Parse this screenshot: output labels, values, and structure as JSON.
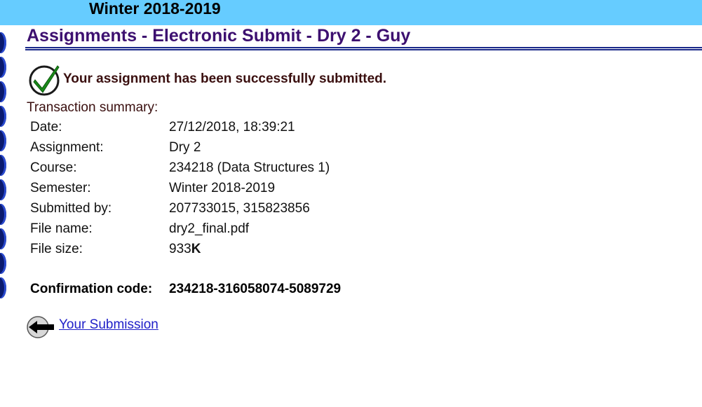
{
  "header": {
    "term_title": "Winter 2018-2019"
  },
  "page": {
    "title": "Assignments - Electronic Submit - Dry 2 - Guy"
  },
  "status": {
    "icon": "checkmark-icon",
    "message": "Your assignment has been successfully submitted."
  },
  "summary": {
    "heading": "Transaction summary:",
    "rows": [
      {
        "label": "Date:",
        "value": "27/12/2018, 18:39:21"
      },
      {
        "label": "Assignment:",
        "value": "Dry 2"
      },
      {
        "label": "Course:",
        "value": "234218 (Data Structures 1)"
      },
      {
        "label": "Semester:",
        "value": "Winter 2018-2019"
      },
      {
        "label": "Submitted by:",
        "value": "207733015, 315823856"
      },
      {
        "label": "File name:",
        "value": "dry2_final.pdf"
      },
      {
        "label": "File size:",
        "value": "933",
        "unit": "K"
      }
    ]
  },
  "confirmation": {
    "label": "Confirmation code:",
    "code": "234218-316058074-5089729"
  },
  "navigation": {
    "back_icon": "back-arrow-icon",
    "back_label": " Your Submission"
  },
  "colors": {
    "header_bg": "#66ccff",
    "title": "#3d1070",
    "link": "#2020c8",
    "check": "#1a8a1a"
  }
}
